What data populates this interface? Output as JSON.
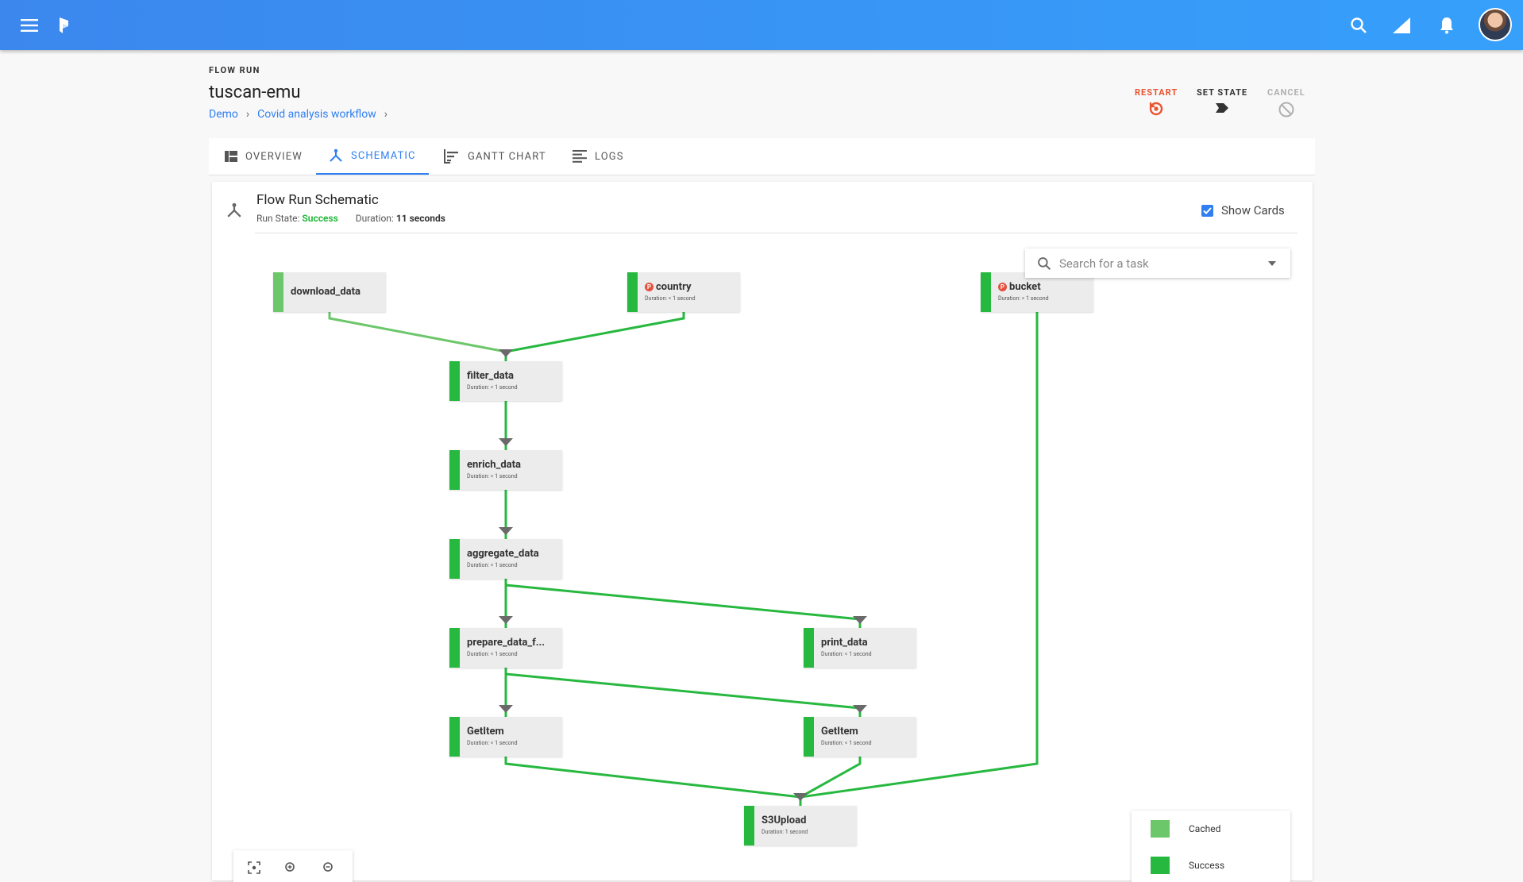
{
  "topbar": {
    "menu_icon": "menu-icon",
    "logo_icon": "prefect-logo-icon",
    "search_icon": "search-icon",
    "signal_icon": "signal-icon",
    "bell_icon": "bell-icon"
  },
  "header": {
    "eyebrow": "FLOW RUN",
    "title": "tuscan-emu",
    "breadcrumbs": [
      "Demo",
      "Covid analysis workflow"
    ],
    "actions": {
      "restart": "RESTART",
      "set_state": "SET STATE",
      "cancel": "CANCEL"
    },
    "colors": {
      "restart": "#e9532f",
      "cancel": "#b0b0b0",
      "accent": "#2f7ff2"
    }
  },
  "tabs": [
    {
      "label": "OVERVIEW",
      "icon": "overview-icon"
    },
    {
      "label": "SCHEMATIC",
      "icon": "schematic-icon",
      "active": true
    },
    {
      "label": "GANTT CHART",
      "icon": "gantt-icon"
    },
    {
      "label": "LOGS",
      "icon": "logs-icon"
    }
  ],
  "schematic": {
    "title": "Flow Run Schematic",
    "run_state_label": "Run State:",
    "run_state": "Success",
    "duration_label": "Duration:",
    "duration": "11 seconds",
    "show_cards": "Show Cards",
    "search_placeholder": "Search for a task"
  },
  "tasks": [
    {
      "name": "download_data",
      "duration": "",
      "state": "cached",
      "param": false
    },
    {
      "name": "country",
      "duration": "Duration: < 1 second",
      "state": "success",
      "param": true
    },
    {
      "name": "bucket",
      "duration": "Duration: < 1 second",
      "state": "success",
      "param": true
    },
    {
      "name": "filter_data",
      "duration": "Duration: < 1 second",
      "state": "success",
      "param": false
    },
    {
      "name": "enrich_data",
      "duration": "Duration: < 1 second",
      "state": "success",
      "param": false
    },
    {
      "name": "aggregate_data",
      "duration": "Duration: < 1 second",
      "state": "success",
      "param": false
    },
    {
      "name": "prepare_data_f...",
      "duration": "Duration: < 1 second",
      "state": "success",
      "param": false
    },
    {
      "name": "print_data",
      "duration": "Duration: < 1 second",
      "state": "success",
      "param": false
    },
    {
      "name": "GetItem",
      "duration": "Duration: < 1 second",
      "state": "success",
      "param": false
    },
    {
      "name": "GetItem",
      "duration": "Duration: < 1 second",
      "state": "success",
      "param": false
    },
    {
      "name": "S3Upload",
      "duration": "Duration: 1 second",
      "state": "success",
      "param": false
    }
  ],
  "legend": [
    {
      "label": "Cached",
      "color": "#6cc66a"
    },
    {
      "label": "Success",
      "color": "#27b83f"
    }
  ]
}
